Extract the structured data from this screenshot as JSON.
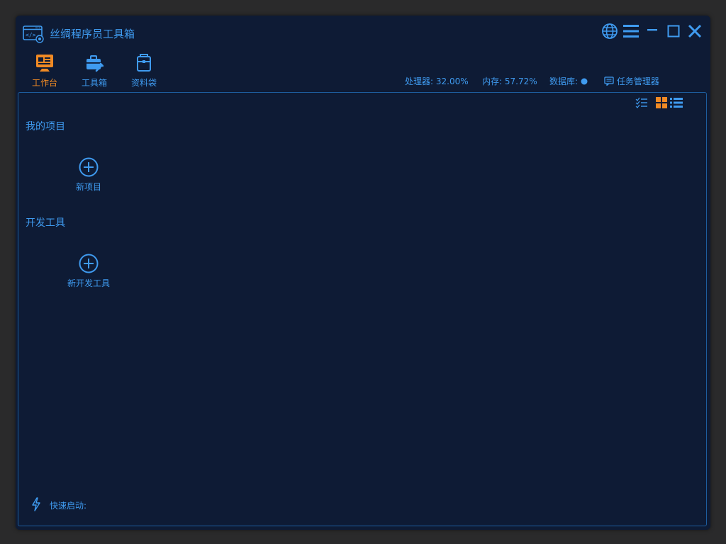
{
  "app": {
    "title": "丝绸程序员工具箱"
  },
  "colors": {
    "accent": "#3f9bf0",
    "active": "#f08a24",
    "background": "#0e1b35",
    "border": "#1d5d9e"
  },
  "window_controls": {
    "icons": [
      "globe-icon",
      "menu-icon",
      "minimize-icon",
      "maximize-icon",
      "close-icon"
    ]
  },
  "nav": {
    "tabs": [
      {
        "label": "工作台",
        "icon": "workbench-icon",
        "active": true
      },
      {
        "label": "工具箱",
        "icon": "toolbox-icon",
        "active": false
      },
      {
        "label": "资料袋",
        "icon": "bag-icon",
        "active": false
      }
    ]
  },
  "status": {
    "cpu": "处理器: 32.00%",
    "memory": "内存: 57.72%",
    "database_label": "数据库:",
    "database_state": "connected",
    "task_manager": "任务管理器"
  },
  "view_toggles": [
    "checklist-icon",
    "grid-view-icon",
    "list-view-icon"
  ],
  "sections": [
    {
      "title": "我的项目",
      "add_label": "新项目"
    },
    {
      "title": "开发工具",
      "add_label": "新开发工具"
    }
  ],
  "quick_launch": {
    "label": "快速启动:"
  }
}
